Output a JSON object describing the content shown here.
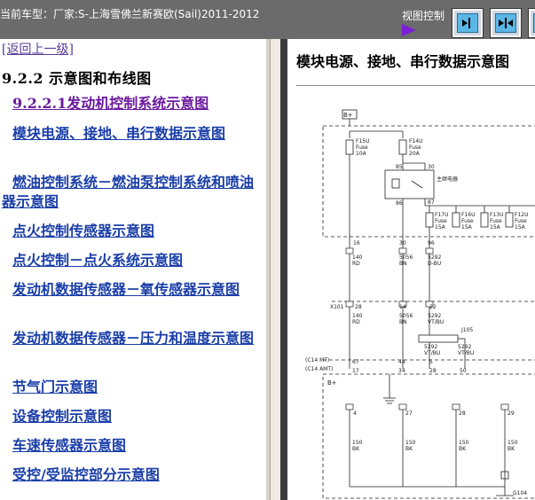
{
  "header": {
    "car_label": "当前车型：厂家:S-上海雪佛兰新赛欧(Sail)2011-2012",
    "view_control_label": "视图控制"
  },
  "nav": {
    "back_link": "[返回上一级]",
    "section_title": "9.2.2 示意图和布线图",
    "items": [
      {
        "label": "9.2.2.1发动机控制系统示意图"
      },
      {
        "label": "模块电源、接地、串行数据示意图"
      },
      {
        "label": "燃油控制系统－燃油泵控制系统和喷油器示意图"
      },
      {
        "label": "点火控制传感器示意图"
      },
      {
        "label": "点火控制－点火系统示意图"
      },
      {
        "label": "发动机数据传感器－氧传感器示意图"
      },
      {
        "label": "发动机数据传感器－压力和温度示意图"
      },
      {
        "label": "节气门示意图"
      },
      {
        "label": "设备控制示意图"
      },
      {
        "label": "车速传感器示意图"
      },
      {
        "label": "受控/受监控部分示意图"
      }
    ]
  },
  "diagram": {
    "title": "模块电源、接地、串行数据示意图",
    "labels": {
      "b_plus": "B+",
      "fuse_f15u": "F15U",
      "fuse_f15u_sub": "Fuse",
      "fuse_f15u_amp": "10A",
      "fuse_f14u": "F14U",
      "fuse_f14u_sub": "Fuse",
      "fuse_f14u_amp": "20A",
      "relay_85": "85",
      "relay_30": "30",
      "relay_name": "主继电器",
      "relay_86": "86",
      "relay_87": "87",
      "f17u": "F17U",
      "f17u_sub": "Fuse",
      "f17u_amp": "15A",
      "f16u": "F16U",
      "f16u_sub": "Fuse",
      "f16u_amp": "15A",
      "f13u": "F13U",
      "f13u_sub": "Fuse",
      "f13u_amp": "15A",
      "f12u": "F12U",
      "f12u_sub": "Fuse",
      "f12u_amp": "15A",
      "pin_16": "16",
      "pin_30": "30",
      "pin_96": "96",
      "w1_num": "140",
      "w1_col": "RD",
      "w2_num": "5056",
      "w2_col": "BN",
      "w3_num": "5292",
      "w3_col": "D-BU",
      "x101": "X101",
      "x_28": "28",
      "x_14": "14",
      "x_22": "22",
      "w4_num": "140",
      "w4_col": "RD",
      "w5_num": "5056",
      "w5_col": "BN",
      "w6_num": "5292",
      "w6_col": "VT/BU",
      "j105": "J105",
      "w7_num": "5292",
      "w7_col": "VT/BU",
      "w8_num": "5292",
      "w8_col": "VT/BU",
      "c14_mt": "(C14 MT)",
      "c14_amt": "(C14 AMT)",
      "mt_67": "67",
      "mt_44": "44",
      "mt_5": "5",
      "amt_17": "17",
      "amt_34": "34",
      "amt_28": "28",
      "amt_50": "50",
      "ecm_bplus": "B+",
      "g_4": "4",
      "g_27": "27",
      "g_28": "28",
      "g_29": "29",
      "g1_num": "150",
      "g1_col": "BK",
      "g2_num": "150",
      "g2_col": "BK",
      "g3_num": "150",
      "g3_col": "BK",
      "g4_num": "150",
      "g4_col": "BK",
      "ground": "G104"
    }
  },
  "colors": {
    "header_bg": "#6b6b6b",
    "link": "#1a3ea8",
    "current_link": "#6a1a9e",
    "accent_triangle": "#7a1fd6"
  }
}
